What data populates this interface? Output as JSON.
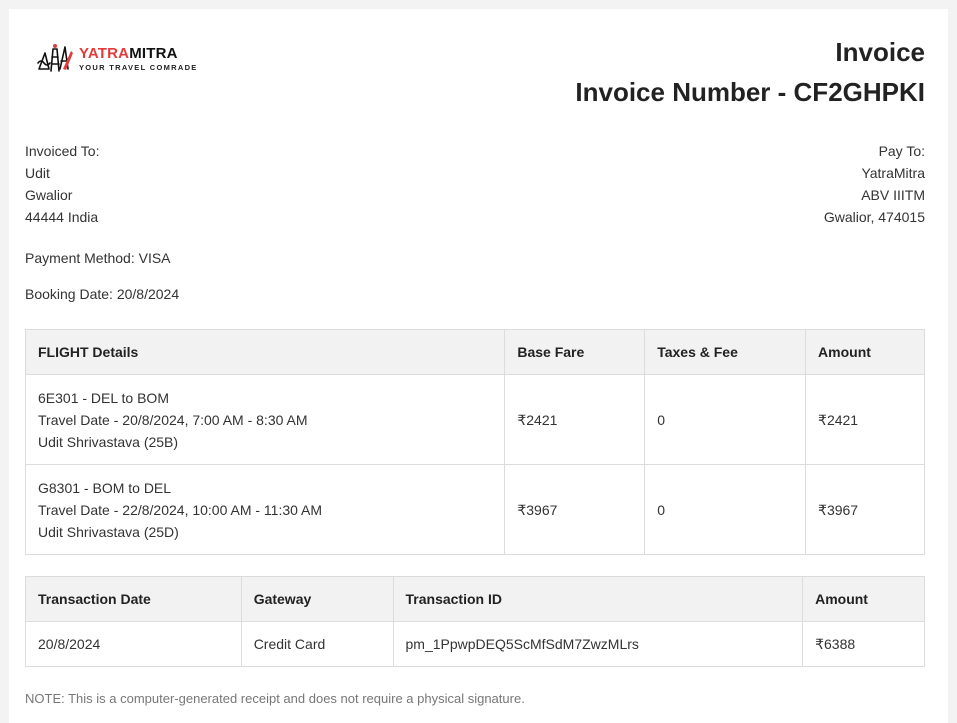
{
  "brand": {
    "name_part1": "YATRA",
    "name_part2": "MITRA",
    "tagline": "YOUR TRAVEL COMRADE",
    "accent_color": "#e23b3b"
  },
  "title": "Invoice",
  "invoice_number_line": "Invoice Number - CF2GHPKI",
  "invoiced_to": {
    "label": "Invoiced To:",
    "lines": [
      "Udit",
      "Gwalior",
      "44444 India"
    ]
  },
  "pay_to": {
    "label": "Pay To:",
    "lines": [
      "YatraMitra",
      "ABV IIITM",
      "Gwalior, 474015"
    ]
  },
  "payment_method": "Payment Method: VISA",
  "booking_date": "Booking Date: 20/8/2024",
  "flights_table": {
    "headers": [
      "FLIGHT Details",
      "Base Fare",
      "Taxes & Fee",
      "Amount"
    ],
    "rows": [
      {
        "details": [
          "6E301 - DEL to BOM",
          "Travel Date - 20/8/2024, 7:00 AM - 8:30 AM",
          "Udit Shrivastava (25B)"
        ],
        "base_fare": "₹2421",
        "taxes": "0",
        "amount": "₹2421"
      },
      {
        "details": [
          "G8301 - BOM to DEL",
          "Travel Date - 22/8/2024, 10:00 AM - 11:30 AM",
          "Udit Shrivastava (25D)"
        ],
        "base_fare": "₹3967",
        "taxes": "0",
        "amount": "₹3967"
      }
    ]
  },
  "transactions_table": {
    "headers": [
      "Transaction Date",
      "Gateway",
      "Transaction ID",
      "Amount"
    ],
    "rows": [
      {
        "date": "20/8/2024",
        "gateway": "Credit Card",
        "transaction_id": "pm_1PpwpDEQ5ScMfSdM7ZwzMLrs",
        "amount": "₹6388"
      }
    ]
  },
  "note": "NOTE: This is a computer-generated receipt and does not require a physical signature."
}
